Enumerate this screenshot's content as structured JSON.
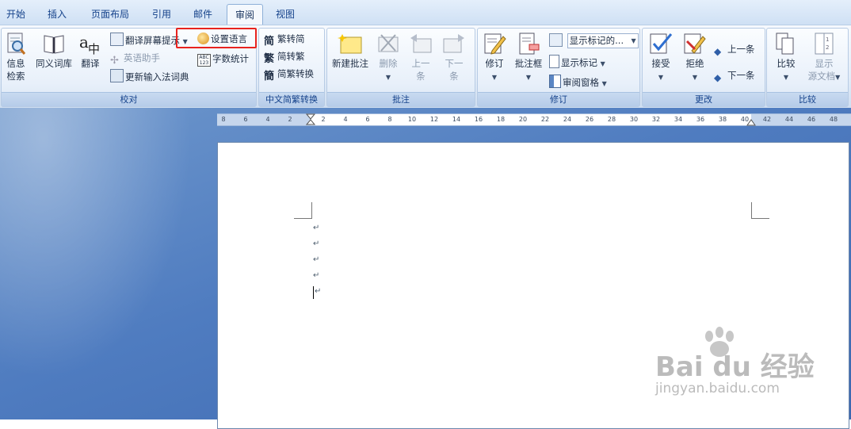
{
  "tabs": [
    "开始",
    "插入",
    "页面布局",
    "引用",
    "邮件",
    "审阅",
    "视图"
  ],
  "active_tab": "审阅",
  "proofing": {
    "group_label": "校对",
    "research_label_1": "信息",
    "research_label_2": "检索",
    "thesaurus_label": "同义词库",
    "translate_label": "翻译",
    "screen_tip_label": "翻译屏幕提示",
    "english_assistant_label": "英语助手",
    "update_ime_label": "更新输入法词典",
    "set_language_label": "设置语言",
    "word_count_label": "字数统计"
  },
  "chinese_conversion": {
    "group_label": "中文简繁转换",
    "to_simplified_label": "繁转简",
    "to_traditional_label": "简转繁",
    "conversion_label": "简繁转换"
  },
  "comments": {
    "group_label": "批注",
    "new_comment_label": "新建批注",
    "delete_label": "删除",
    "previous_label_1": "上一",
    "previous_label_2": "条",
    "next_label_1": "下一",
    "next_label_2": "条"
  },
  "tracking": {
    "group_label": "修订",
    "track_changes_label": "修订",
    "balloons_label": "批注框",
    "display_dropdown_value": "显示标记的...",
    "show_markup_label": "显示标记",
    "reviewing_pane_label": "审阅窗格"
  },
  "changes": {
    "group_label": "更改",
    "accept_label": "接受",
    "reject_label": "拒绝",
    "previous_label": "上一条",
    "next_label": "下一条"
  },
  "compare": {
    "group_label": "比较",
    "compare_label": "比较",
    "show_source_label_1": "显示",
    "show_source_label_2": "源文档"
  },
  "ruler_labels": [
    "8",
    "6",
    "4",
    "2",
    "2",
    "4",
    "6",
    "8",
    "10",
    "12",
    "14",
    "16",
    "18",
    "20",
    "22",
    "24",
    "26",
    "28",
    "30",
    "32",
    "34",
    "36",
    "38",
    "40",
    "42",
    "44",
    "46",
    "48"
  ],
  "paragraph_mark": "↵",
  "watermark": {
    "brand": "Bai du 经验",
    "url": "jingyan.baidu.com"
  },
  "colors": {
    "highlight": "#e8231e",
    "workspace": "#4f7cc0",
    "ribbon_text": "#15428b"
  }
}
